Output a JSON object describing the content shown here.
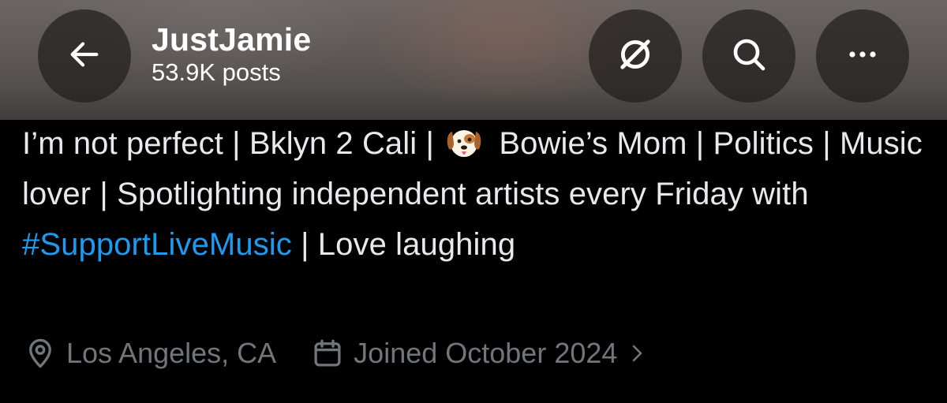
{
  "header": {
    "profile_name": "JustJamie",
    "posts_count": "53.9K posts",
    "buttons": {
      "back_icon": "arrow-left-icon",
      "grok_icon": "grok-icon",
      "search_icon": "search-icon",
      "more_icon": "more-horizontal-icon"
    }
  },
  "bio": {
    "line1_before_emoji": "I’m not perfect | Bklyn 2 Cali | ",
    "emoji_name": "dog-face-emoji",
    "line1_after_emoji": " Bowie’s Mom |",
    "middle_text": " Politics | Music lover | Spotlighting independent artists every Friday with ",
    "hashtag": "#SupportLiveMusic",
    "end_text": " | Love laughing"
  },
  "meta": {
    "location": "Los Angeles, CA",
    "location_icon": "location-pin-icon",
    "joined": "Joined October 2024",
    "joined_icon": "calendar-icon",
    "chevron_icon": "chevron-right-icon"
  },
  "colors": {
    "background": "#000000",
    "text": "#e7e9ea",
    "muted": "#71767b",
    "link": "#1d9bf0"
  }
}
